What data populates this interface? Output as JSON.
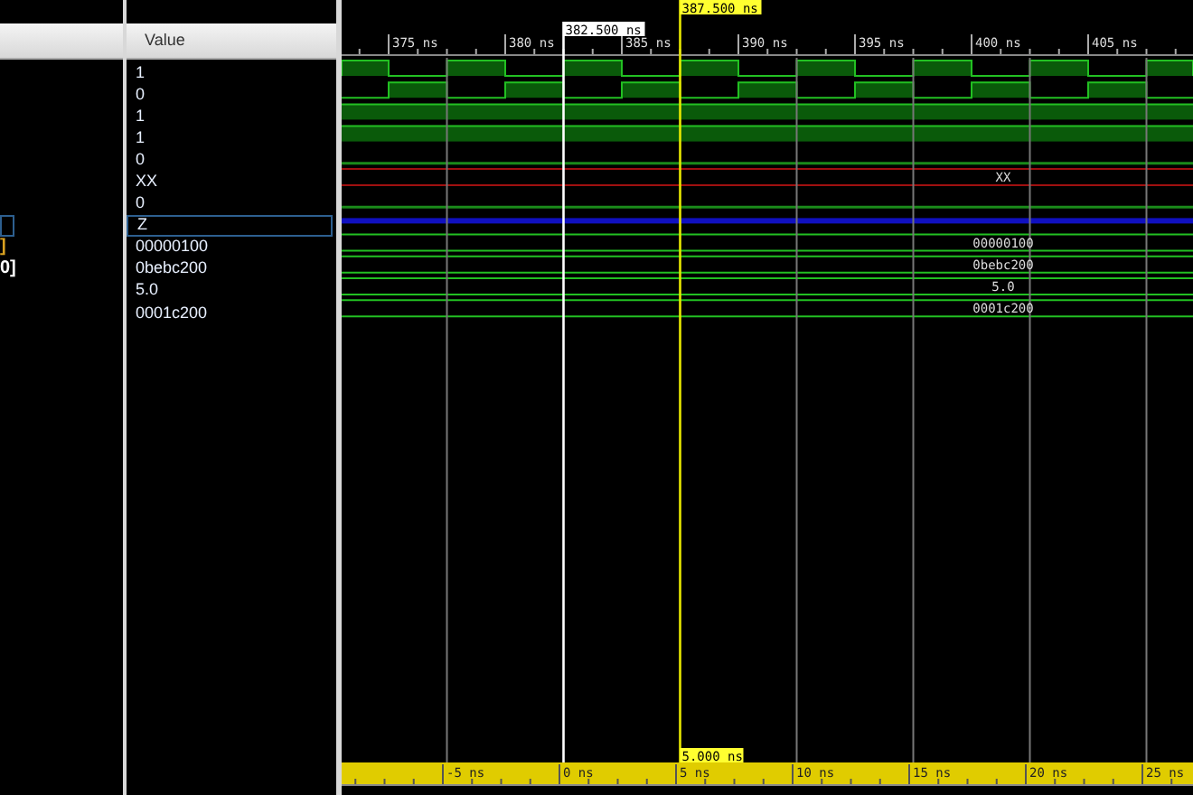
{
  "value_header": "Value",
  "signals": [
    {
      "value": "1",
      "kind": "clock",
      "selected": false
    },
    {
      "value": "0",
      "kind": "clock_inv",
      "selected": false
    },
    {
      "value": "1",
      "kind": "high",
      "selected": false
    },
    {
      "value": "1",
      "kind": "high",
      "selected": false
    },
    {
      "value": "0",
      "kind": "low",
      "selected": false
    },
    {
      "value": "XX",
      "kind": "bus_x",
      "wave_label": "XX",
      "selected": false
    },
    {
      "value": "0",
      "kind": "low",
      "selected": false
    },
    {
      "value": "Z",
      "kind": "bus_z",
      "selected": true
    },
    {
      "name": "]",
      "value": "00000100",
      "kind": "bus",
      "wave_label": "00000100",
      "selected": false,
      "color": "#d8a020"
    },
    {
      "name": "0]",
      "value": "0bebc200",
      "kind": "bus",
      "wave_label": "0bebc200",
      "selected": false,
      "color": "#ffffff"
    },
    {
      "value": "5.0",
      "kind": "bus",
      "wave_label": "5.0",
      "selected": false
    },
    {
      "value": "0001c200",
      "kind": "bus",
      "wave_label": "0001c200",
      "selected": false
    }
  ],
  "top_ruler": [
    "375 ns",
    "380 ns",
    "385 ns",
    "390 ns",
    "395 ns",
    "400 ns",
    "405 ns"
  ],
  "cursors": [
    {
      "kind": "marker",
      "label": "382.500 ns"
    },
    {
      "kind": "main",
      "label": "387.500 ns"
    }
  ],
  "delta": "5.000 ns",
  "bottom_ruler": [
    "-5 ns",
    "0 ns",
    "5 ns",
    "10 ns",
    "15 ns",
    "20 ns",
    "25 ns"
  ]
}
